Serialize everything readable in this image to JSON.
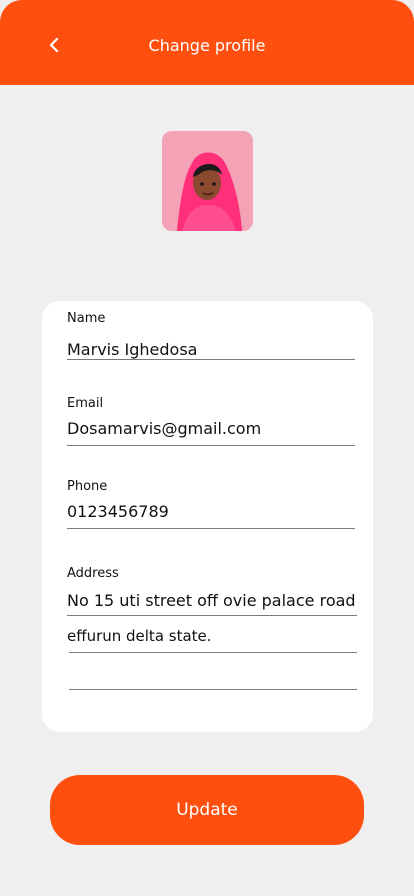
{
  "header": {
    "title": "Change profile",
    "back_icon": "chevron-left-icon"
  },
  "avatar": {
    "icon": "user-avatar"
  },
  "form": {
    "name_label": "Name",
    "name_value": "Marvis Ighedosa",
    "email_label": "Email",
    "email_value": "Dosamarvis@gmail.com",
    "phone_label": "Phone",
    "phone_value": "0123456789",
    "address_label": "Address",
    "address_line1": "No 15 uti street off ovie palace road",
    "address_line2": "effurun delta state.",
    "address_line3": ""
  },
  "actions": {
    "update_label": "Update"
  },
  "colors": {
    "accent": "#ff4f0f",
    "background": "#efefef",
    "card": "#ffffff"
  }
}
